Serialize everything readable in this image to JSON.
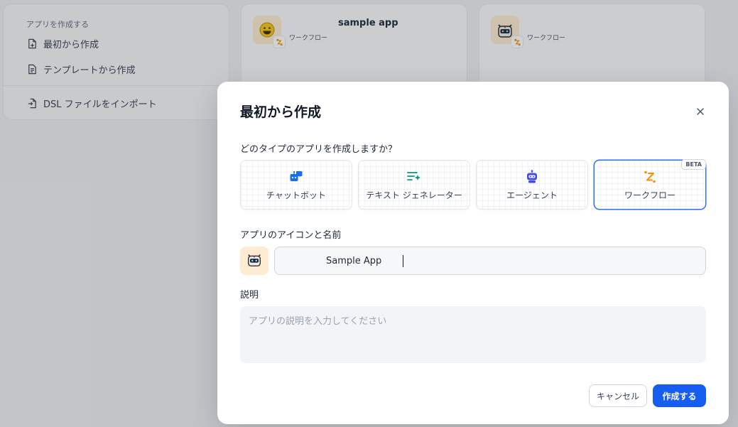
{
  "background": {
    "create_panel": {
      "section_title": "アプリを作成する",
      "items": [
        {
          "label": "最初から作成",
          "icon": "file-plus-icon"
        },
        {
          "label": "テンプレートから作成",
          "icon": "file-template-icon"
        },
        {
          "label": "DSL ファイルをインポート",
          "icon": "file-import-icon"
        }
      ]
    },
    "app_cards": [
      {
        "name": "sample app",
        "type": "ワークフロー",
        "icon": "grinning-face-icon"
      },
      {
        "name": "",
        "type": "ワークフロー",
        "icon": "robot-face-icon"
      }
    ]
  },
  "modal": {
    "title": "最初から作成",
    "close_icon": "close-icon",
    "type_question": "どのタイプのアプリを作成しますか？",
    "types": [
      {
        "label": "チャットボット",
        "icon": "chatbot-icon",
        "color": "#1570ef",
        "selected": false
      },
      {
        "label": "テキスト ジェネレーター",
        "icon": "text-generator-icon",
        "color": "#0e9384",
        "selected": false
      },
      {
        "label": "エージェント",
        "icon": "agent-robot-icon",
        "color": "#444ce7",
        "selected": false
      },
      {
        "label": "ワークフロー",
        "icon": "workflow-icon",
        "color": "#f79009",
        "selected": true,
        "badge": "BETA"
      }
    ],
    "name_label": "アプリのアイコンと名前",
    "name_value": "Sample App",
    "description_label": "説明",
    "description_placeholder": "アプリの説明を入力してください",
    "cancel_label": "キャンセル",
    "create_label": "作成する"
  },
  "colors": {
    "primary": "#155eef",
    "selected_border": "#2970ff",
    "icon_bg": "#fdecd2"
  }
}
